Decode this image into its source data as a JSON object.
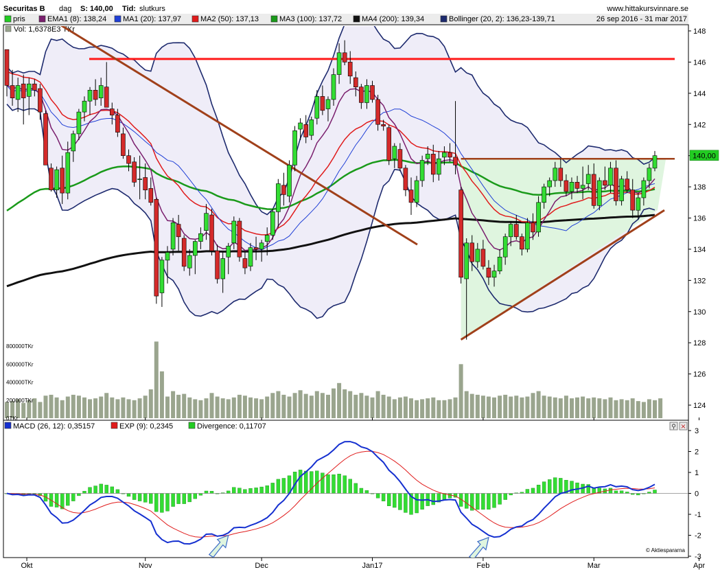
{
  "header": {
    "ticker": "Securitas B",
    "period": "dag",
    "last_label": "S: 140,00",
    "tid_label": "Tid:",
    "tid_value": "slutkurs",
    "site": "www.hittakursvinnare.se",
    "date_range": "26 sep 2016 - 31 mar 2017",
    "vol_label": "Vol: 1,6378E3 TKr",
    "last_price_tag": "140,00",
    "watermark": "© Aktiespararna",
    "legend": [
      {
        "label": "pris",
        "color": "#22cc22"
      },
      {
        "label": "EMA1 (8): 138,24",
        "color": "#7a1f6e"
      },
      {
        "label": "MA1 (20): 137,97",
        "color": "#1f3fd6"
      },
      {
        "label": "MA2 (50): 137,13",
        "color": "#e01b1b"
      },
      {
        "label": "MA3 (100): 137,72",
        "color": "#1a9a1a"
      },
      {
        "label": "MA4 (200): 139,34",
        "color": "#111111"
      },
      {
        "label": "Bollinger (20, 2): 136,23-139,71",
        "color": "#1d2a6e"
      }
    ],
    "macd_legend": [
      {
        "label": "MACD (26, 12): 0,35157",
        "color": "#1530d0"
      },
      {
        "label": "EXP (9): 0,2345",
        "color": "#e01b1b"
      },
      {
        "label": "Divergence: 0,11707",
        "color": "#22cc22"
      }
    ]
  },
  "colors": {
    "up": "#33dd33",
    "down": "#d42a2a",
    "volume": "#9aa58e",
    "boll_fill": "#efedf8",
    "boll_line": "#1d2a6e",
    "triangle_fill": "#dff5df",
    "trend_brown": "#a0401a",
    "resist_red": "#ff1a1a"
  },
  "chart_data": [
    {
      "type": "candlestick",
      "title": "Securitas B - dag",
      "x_tick_labels": [
        "Okt",
        "Nov",
        "Dec",
        "Jan17",
        "Feb",
        "Mar",
        "Apr"
      ],
      "y_tick_labels": [
        "124",
        "126",
        "128",
        "130",
        "132",
        "134",
        "136",
        "138",
        "140",
        "142",
        "144",
        "146",
        "148"
      ],
      "volume_tick_labels": [
        "0TKr",
        "200000TKr",
        "400000TKr",
        "600000TKr",
        "800000TKr"
      ],
      "ylim": [
        123.4,
        148.2
      ],
      "grid": false,
      "ohlc": [
        [
          146.8,
          146.8,
          143.8,
          144.5
        ],
        [
          144.5,
          145.5,
          143.2,
          143.7
        ],
        [
          143.6,
          145.0,
          142.8,
          144.5
        ],
        [
          144.6,
          145.2,
          142.0,
          143.7
        ],
        [
          143.8,
          145.0,
          142.6,
          144.6
        ],
        [
          144.6,
          144.9,
          143.8,
          144.2
        ],
        [
          144.3,
          144.6,
          142.3,
          142.8
        ],
        [
          142.7,
          142.9,
          139.4,
          139.4
        ],
        [
          139.2,
          139.5,
          137.7,
          137.8
        ],
        [
          137.8,
          139.3,
          137.3,
          139.1
        ],
        [
          139.2,
          140.0,
          136.9,
          137.6
        ],
        [
          137.6,
          140.9,
          137.2,
          140.2
        ],
        [
          140.3,
          141.6,
          139.6,
          141.4
        ],
        [
          141.4,
          143.0,
          141.0,
          142.8
        ],
        [
          142.8,
          143.8,
          142.2,
          143.5
        ],
        [
          143.5,
          144.4,
          142.6,
          144.2
        ],
        [
          144.2,
          144.9,
          143.2,
          143.6
        ],
        [
          143.7,
          145.0,
          143.2,
          144.5
        ],
        [
          144.4,
          146.0,
          143.5,
          143.1
        ],
        [
          143.0,
          143.4,
          142.0,
          142.6
        ],
        [
          142.6,
          143.0,
          141.2,
          141.5
        ],
        [
          141.4,
          141.8,
          139.8,
          140.0
        ],
        [
          140.0,
          140.4,
          139.0,
          139.5
        ],
        [
          139.6,
          139.9,
          138.0,
          138.3
        ],
        [
          138.5,
          140.0,
          137.2,
          138.5
        ],
        [
          138.6,
          139.5,
          137.2,
          137.8
        ],
        [
          137.9,
          138.6,
          136.8,
          137.0
        ],
        [
          137.2,
          137.3,
          130.5,
          131.0
        ],
        [
          131.2,
          133.5,
          130.3,
          133.3
        ],
        [
          133.3,
          134.2,
          131.8,
          133.8
        ],
        [
          134.0,
          136.0,
          133.6,
          135.7
        ],
        [
          135.6,
          136.2,
          133.9,
          134.8
        ],
        [
          134.7,
          134.9,
          132.6,
          132.9
        ],
        [
          132.8,
          134.0,
          132.3,
          133.6
        ],
        [
          133.6,
          134.6,
          132.4,
          134.5
        ],
        [
          134.5,
          135.4,
          134.0,
          135.0
        ],
        [
          135.2,
          136.9,
          134.6,
          136.3
        ],
        [
          136.2,
          136.6,
          133.6,
          133.9
        ],
        [
          133.9,
          134.3,
          131.8,
          132.1
        ],
        [
          132.1,
          133.8,
          131.2,
          133.4
        ],
        [
          133.5,
          134.4,
          132.4,
          134.2
        ],
        [
          134.4,
          136.1,
          134.0,
          135.8
        ],
        [
          135.8,
          136.0,
          133.2,
          133.5
        ],
        [
          133.4,
          133.8,
          132.4,
          132.8
        ],
        [
          132.9,
          134.4,
          132.6,
          134.1
        ],
        [
          134.1,
          134.8,
          133.3,
          134.0
        ],
        [
          134.0,
          134.6,
          133.2,
          134.4
        ],
        [
          134.5,
          135.4,
          133.6,
          134.9
        ],
        [
          134.9,
          136.6,
          134.6,
          136.4
        ],
        [
          136.4,
          138.5,
          135.4,
          138.2
        ],
        [
          138.1,
          138.9,
          136.8,
          137.5
        ],
        [
          137.4,
          139.7,
          137.0,
          139.4
        ],
        [
          139.4,
          141.9,
          139.0,
          141.6
        ],
        [
          141.7,
          142.4,
          141.0,
          142.1
        ],
        [
          142.0,
          142.6,
          140.8,
          141.2
        ],
        [
          141.3,
          142.5,
          141.0,
          142.3
        ],
        [
          142.4,
          144.2,
          142.0,
          143.8
        ],
        [
          143.8,
          144.5,
          142.6,
          142.9
        ],
        [
          143.0,
          143.8,
          142.2,
          143.6
        ],
        [
          143.6,
          145.6,
          143.2,
          145.2
        ],
        [
          145.2,
          147.2,
          144.6,
          146.6
        ],
        [
          146.6,
          147.4,
          145.8,
          146.0
        ],
        [
          146.0,
          146.7,
          144.6,
          145.1
        ],
        [
          145.0,
          145.4,
          143.8,
          144.4
        ],
        [
          144.4,
          144.6,
          143.0,
          143.4
        ],
        [
          143.4,
          144.9,
          143.0,
          144.5
        ],
        [
          144.5,
          144.8,
          143.4,
          143.6
        ],
        [
          143.6,
          143.9,
          141.6,
          142.0
        ],
        [
          142.0,
          142.3,
          141.6,
          141.9
        ],
        [
          141.8,
          142.0,
          139.4,
          139.7
        ],
        [
          139.8,
          140.8,
          139.2,
          140.6
        ],
        [
          140.4,
          140.8,
          139.0,
          139.2
        ],
        [
          139.2,
          139.4,
          137.4,
          137.8
        ],
        [
          137.8,
          138.6,
          136.2,
          137.0
        ],
        [
          137.0,
          138.7,
          136.7,
          138.4
        ],
        [
          138.4,
          140.0,
          138.0,
          139.7
        ],
        [
          139.8,
          140.6,
          139.4,
          140.1
        ],
        [
          140.1,
          140.7,
          138.3,
          138.8
        ],
        [
          138.8,
          140.3,
          138.4,
          139.8
        ],
        [
          139.9,
          140.6,
          139.4,
          140.2
        ],
        [
          140.2,
          140.8,
          139.6,
          139.9
        ],
        [
          139.9,
          143.5,
          138.8,
          139.4
        ],
        [
          137.8,
          138.0,
          131.8,
          132.2
        ],
        [
          132.1,
          134.7,
          128.2,
          134.4
        ],
        [
          134.4,
          134.9,
          132.6,
          133.2
        ],
        [
          133.2,
          134.4,
          132.8,
          134.0
        ],
        [
          134.0,
          134.6,
          132.7,
          132.9
        ],
        [
          132.8,
          133.3,
          131.7,
          132.2
        ],
        [
          132.2,
          133.0,
          131.6,
          132.6
        ],
        [
          132.6,
          134.0,
          132.4,
          133.5
        ],
        [
          133.5,
          135.0,
          133.0,
          134.8
        ],
        [
          134.8,
          135.8,
          134.2,
          135.6
        ],
        [
          135.6,
          136.2,
          134.6,
          134.8
        ],
        [
          134.8,
          135.0,
          133.6,
          134.0
        ],
        [
          134.0,
          136.0,
          133.8,
          135.7
        ],
        [
          135.7,
          136.3,
          134.6,
          135.1
        ],
        [
          135.1,
          137.4,
          134.8,
          137.0
        ],
        [
          137.0,
          138.2,
          136.6,
          138.0
        ],
        [
          138.0,
          138.6,
          137.4,
          138.4
        ],
        [
          138.4,
          139.6,
          138.0,
          139.2
        ],
        [
          139.2,
          139.8,
          138.0,
          138.4
        ],
        [
          138.4,
          138.8,
          137.4,
          137.7
        ],
        [
          137.7,
          138.6,
          137.2,
          138.3
        ],
        [
          138.3,
          138.7,
          137.6,
          137.9
        ],
        [
          137.9,
          139.3,
          137.2,
          138.1
        ],
        [
          138.2,
          139.4,
          137.8,
          138.8
        ],
        [
          138.8,
          139.5,
          136.6,
          136.8
        ],
        [
          136.8,
          138.6,
          136.5,
          138.4
        ],
        [
          138.4,
          139.3,
          137.8,
          138.1
        ],
        [
          138.1,
          139.6,
          137.6,
          139.2
        ],
        [
          139.2,
          139.7,
          136.8,
          137.1
        ],
        [
          137.1,
          138.7,
          136.8,
          138.5
        ],
        [
          138.5,
          139.0,
          137.6,
          137.8
        ],
        [
          137.8,
          138.5,
          136.0,
          136.5
        ],
        [
          136.5,
          137.6,
          135.9,
          137.3
        ],
        [
          137.3,
          138.6,
          136.8,
          138.4
        ],
        [
          138.4,
          139.5,
          137.9,
          139.2
        ],
        [
          139.2,
          140.3,
          139.0,
          140.0
        ]
      ],
      "volume_tkr": [
        180,
        190,
        210,
        170,
        200,
        220,
        180,
        250,
        260,
        230,
        200,
        240,
        260,
        250,
        230,
        210,
        220,
        240,
        280,
        230,
        210,
        230,
        210,
        200,
        220,
        250,
        320,
        850,
        520,
        240,
        300,
        260,
        270,
        230,
        210,
        200,
        220,
        280,
        240,
        220,
        210,
        230,
        260,
        250,
        230,
        220,
        210,
        240,
        280,
        300,
        260,
        240,
        280,
        310,
        270,
        250,
        300,
        280,
        260,
        330,
        390,
        320,
        300,
        260,
        280,
        250,
        230,
        300,
        260,
        240,
        210,
        230,
        240,
        220,
        200,
        210,
        220,
        230,
        200,
        200,
        210,
        230,
        600,
        300,
        270,
        260,
        250,
        240,
        230,
        250,
        260,
        240,
        250,
        230,
        240,
        280,
        300,
        250,
        240,
        230,
        220,
        250,
        220,
        230,
        240,
        220,
        230,
        220,
        210,
        230,
        200,
        210,
        200,
        220,
        190,
        180,
        210,
        200,
        220
      ],
      "trendlines_y": {
        "resistance_red": 146.2,
        "upper_horizontal": 139.8,
        "brown_down_from": 148.6,
        "brown_down_to": 134.3,
        "triangle_base_low": 128.2,
        "triangle_base_high": 136.5
      }
    },
    {
      "type": "macd",
      "title": "MACD (26, 12): 0,35157",
      "ylim": [
        -3,
        3
      ],
      "y_tick_labels": [
        "-3",
        "-2",
        "-1",
        "0",
        "1",
        "2",
        "3"
      ],
      "series_names": [
        "MACD (26, 12)",
        "EXP (9)",
        "Divergence"
      ]
    }
  ]
}
